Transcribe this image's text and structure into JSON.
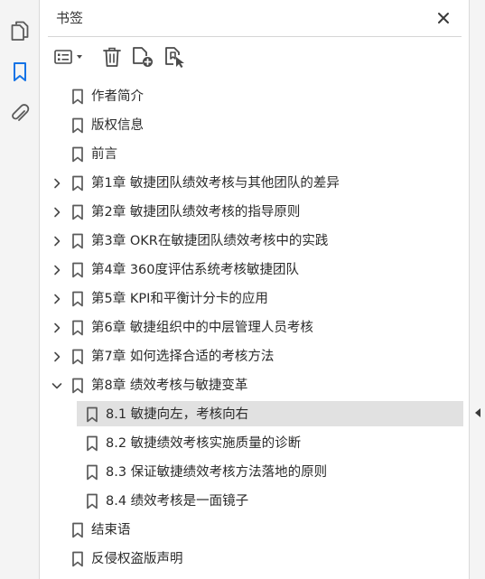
{
  "panel": {
    "title": "书签"
  },
  "bookmarks": [
    {
      "label": "作者简介",
      "level": 0,
      "expander": "none",
      "selected": false
    },
    {
      "label": "版权信息",
      "level": 0,
      "expander": "none",
      "selected": false
    },
    {
      "label": "前言",
      "level": 0,
      "expander": "none",
      "selected": false
    },
    {
      "label": "第1章 敏捷团队绩效考核与其他团队的差异",
      "level": 0,
      "expander": "collapsed",
      "selected": false
    },
    {
      "label": "第2章 敏捷团队绩效考核的指导原则",
      "level": 0,
      "expander": "collapsed",
      "selected": false
    },
    {
      "label": "第3章 OKR在敏捷团队绩效考核中的实践",
      "level": 0,
      "expander": "collapsed",
      "selected": false
    },
    {
      "label": "第4章 360度评估系统考核敏捷团队",
      "level": 0,
      "expander": "collapsed",
      "selected": false
    },
    {
      "label": "第5章 KPI和平衡计分卡的应用",
      "level": 0,
      "expander": "collapsed",
      "selected": false
    },
    {
      "label": "第6章 敏捷组织中的中层管理人员考核",
      "level": 0,
      "expander": "collapsed",
      "selected": false
    },
    {
      "label": "第7章 如何选择合适的考核方法",
      "level": 0,
      "expander": "collapsed",
      "selected": false
    },
    {
      "label": "第8章 绩效考核与敏捷变革",
      "level": 0,
      "expander": "expanded",
      "selected": false
    },
    {
      "label": "8.1 敏捷向左，考核向右",
      "level": 1,
      "expander": "none",
      "selected": true
    },
    {
      "label": "8.2 敏捷绩效考核实施质量的诊断",
      "level": 1,
      "expander": "none",
      "selected": false
    },
    {
      "label": "8.3 保证敏捷绩效考核方法落地的原则",
      "level": 1,
      "expander": "none",
      "selected": false
    },
    {
      "label": "8.4 绩效考核是一面镜子",
      "level": 1,
      "expander": "none",
      "selected": false
    },
    {
      "label": "结束语",
      "level": 0,
      "expander": "none",
      "selected": false
    },
    {
      "label": "反侵权盗版声明",
      "level": 0,
      "expander": "none",
      "selected": false
    }
  ],
  "icons": {
    "rail": [
      "pages-icon",
      "bookmarks-icon",
      "attachments-icon"
    ],
    "toolbar": [
      "options-menu-icon",
      "delete-bookmark-icon",
      "new-bookmark-icon",
      "new-bookmark-from-structure-icon"
    ]
  },
  "colors": {
    "accent": "#1473e6",
    "selected_row": "#e1e1e1",
    "text": "#2b2b2b"
  }
}
